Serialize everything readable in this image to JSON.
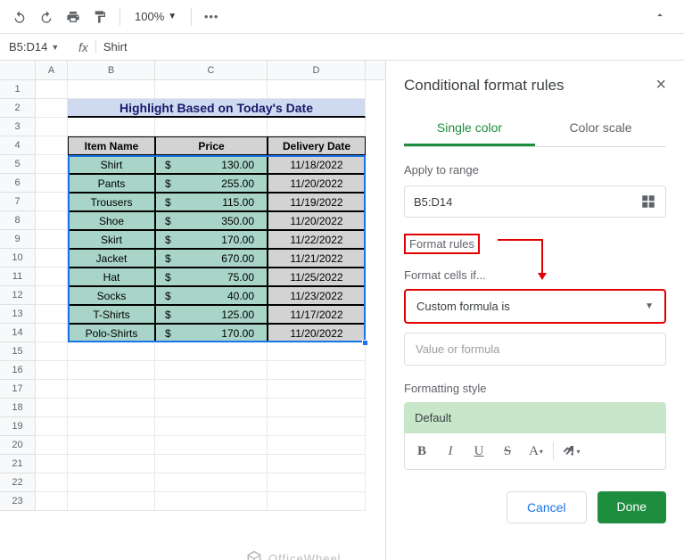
{
  "toolbar": {
    "zoom": "100%"
  },
  "namebox": "B5:D14",
  "formula_bar_value": "Shirt",
  "columns": [
    "A",
    "B",
    "C",
    "D"
  ],
  "title_banner": "Highlight Based on Today's Date",
  "headers": {
    "item": "Item Name",
    "price": "Price",
    "date": "Delivery Date"
  },
  "rows": [
    {
      "item": "Shirt",
      "price": "130.00",
      "date": "11/18/2022"
    },
    {
      "item": "Pants",
      "price": "255.00",
      "date": "11/20/2022"
    },
    {
      "item": "Trousers",
      "price": "115.00",
      "date": "11/19/2022"
    },
    {
      "item": "Shoe",
      "price": "350.00",
      "date": "11/20/2022"
    },
    {
      "item": "Skirt",
      "price": "170.00",
      "date": "11/22/2022"
    },
    {
      "item": "Jacket",
      "price": "670.00",
      "date": "11/21/2022"
    },
    {
      "item": "Hat",
      "price": "75.00",
      "date": "11/25/2022"
    },
    {
      "item": "Socks",
      "price": "40.00",
      "date": "11/23/2022"
    },
    {
      "item": "T-Shirts",
      "price": "125.00",
      "date": "11/17/2022"
    },
    {
      "item": "Polo-Shirts",
      "price": "170.00",
      "date": "11/20/2022"
    }
  ],
  "currency_symbol": "$",
  "panel": {
    "title": "Conditional format rules",
    "tabs": {
      "single": "Single color",
      "scale": "Color scale"
    },
    "apply_label": "Apply to range",
    "range": "B5:D14",
    "rules_label": "Format rules",
    "cells_if_label": "Format cells if...",
    "condition": "Custom formula is",
    "value_placeholder": "Value or formula",
    "style_label": "Formatting style",
    "style_preview": "Default",
    "cancel": "Cancel",
    "done": "Done"
  },
  "watermark": "OfficeWheel"
}
